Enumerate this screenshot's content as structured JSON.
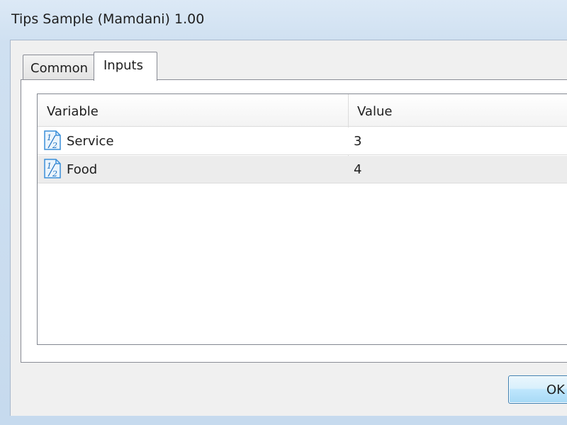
{
  "window": {
    "title": "Tips Sample (Mamdani) 1.00"
  },
  "tabs": [
    {
      "label": "Common",
      "active": false
    },
    {
      "label": "Inputs",
      "active": true
    }
  ],
  "grid": {
    "columns": [
      "Variable",
      "Value"
    ],
    "rows": [
      {
        "icon": "fraction-half-icon",
        "variable": "Service",
        "value": "3"
      },
      {
        "icon": "fraction-half-icon",
        "variable": "Food",
        "value": "4"
      }
    ]
  },
  "buttons": {
    "ok_label": "OK"
  }
}
